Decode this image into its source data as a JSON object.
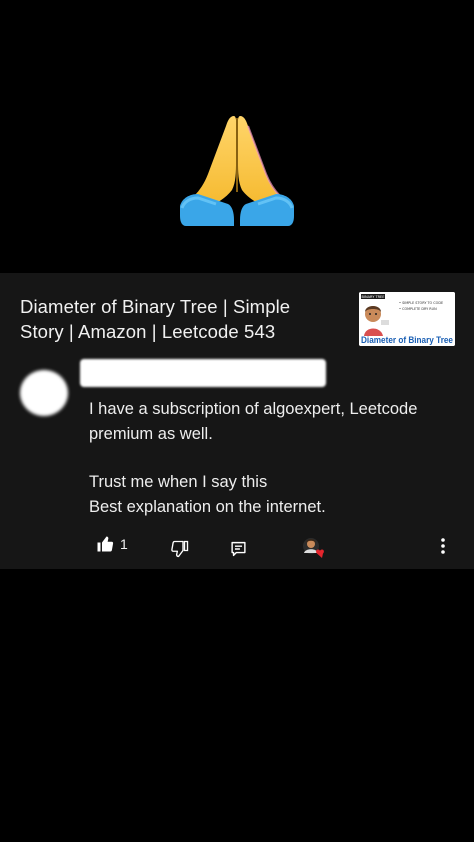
{
  "video": {
    "title_line1": "Diameter of Binary Tree | Simple",
    "title_line2": "Story | Amazon | Leetcode 543",
    "thumbnail": {
      "badge": "BINARY TREE",
      "bullet1": "• SIMPLE STORY TO CODE",
      "bullet2": "• COMPLETE DRY RUN",
      "caption": "Diameter of Binary Tree"
    }
  },
  "comment": {
    "text_line1": "I have a subscription of algoexpert, Leetcode",
    "text_line2": "premium as well.",
    "text_line3": "Trust me when I say this",
    "text_line4": "Best explanation on the internet.",
    "like_count": "1"
  },
  "icons": {
    "emoji": "folded-hands",
    "like": "thumbs-up-icon",
    "dislike": "thumbs-down-icon",
    "reply": "reply-icon",
    "heart": "creator-heart-icon",
    "more": "more-vert-icon"
  },
  "colors": {
    "background": "#000000",
    "card": "#161616",
    "heart": "#e5252d",
    "thumb_caption": "#1a5fb4"
  }
}
